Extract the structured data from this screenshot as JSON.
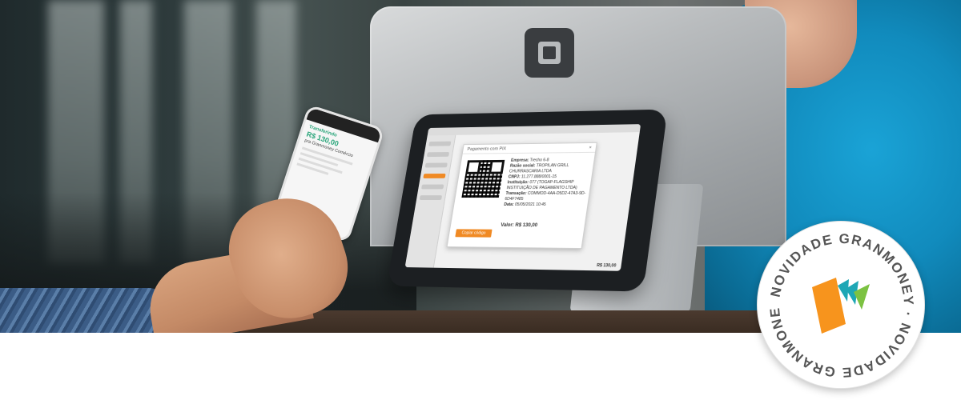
{
  "tablet": {
    "modal_title": "Pagamento com PIX",
    "close_glyph": "×",
    "empresa_label": "Empresa:",
    "empresa_value": "Trecho 6-8",
    "razao_label": "Razão social:",
    "razao_value": "TROPILAN GRILL CHURRASCARIA LTDA",
    "cnpj_label": "CNPJ:",
    "cnpj_value": "11.277.888/0001-15",
    "instituicao_label": "Instituição:",
    "instituicao_value": "077 (TOGAP-FLAGSHIP INSTITUIÇÃO DE PAGAMENTO LTDA)",
    "transacao_label": "Transação:",
    "transacao_value": "COMMOD-4AA-D5D2-47A3-9D-6D4F7485",
    "data_label": "Data:",
    "data_value": "05/05/2021 10:45",
    "valor_label": "Valor:",
    "valor_value": "R$ 130,00",
    "copy_button": "Copiar código",
    "total": "R$ 130,00"
  },
  "phone": {
    "title": "Transferindo",
    "amount": "R$ 130,00",
    "subtitle": "pra Granmoney Comércio"
  },
  "badge": {
    "text": "NOVIDADE GRANMONEY · NOVIDADE GRANMONEY ·",
    "colors": {
      "orange": "#f7941d",
      "teal": "#1ea7b5",
      "green": "#7cc242",
      "text": "#555555"
    }
  }
}
